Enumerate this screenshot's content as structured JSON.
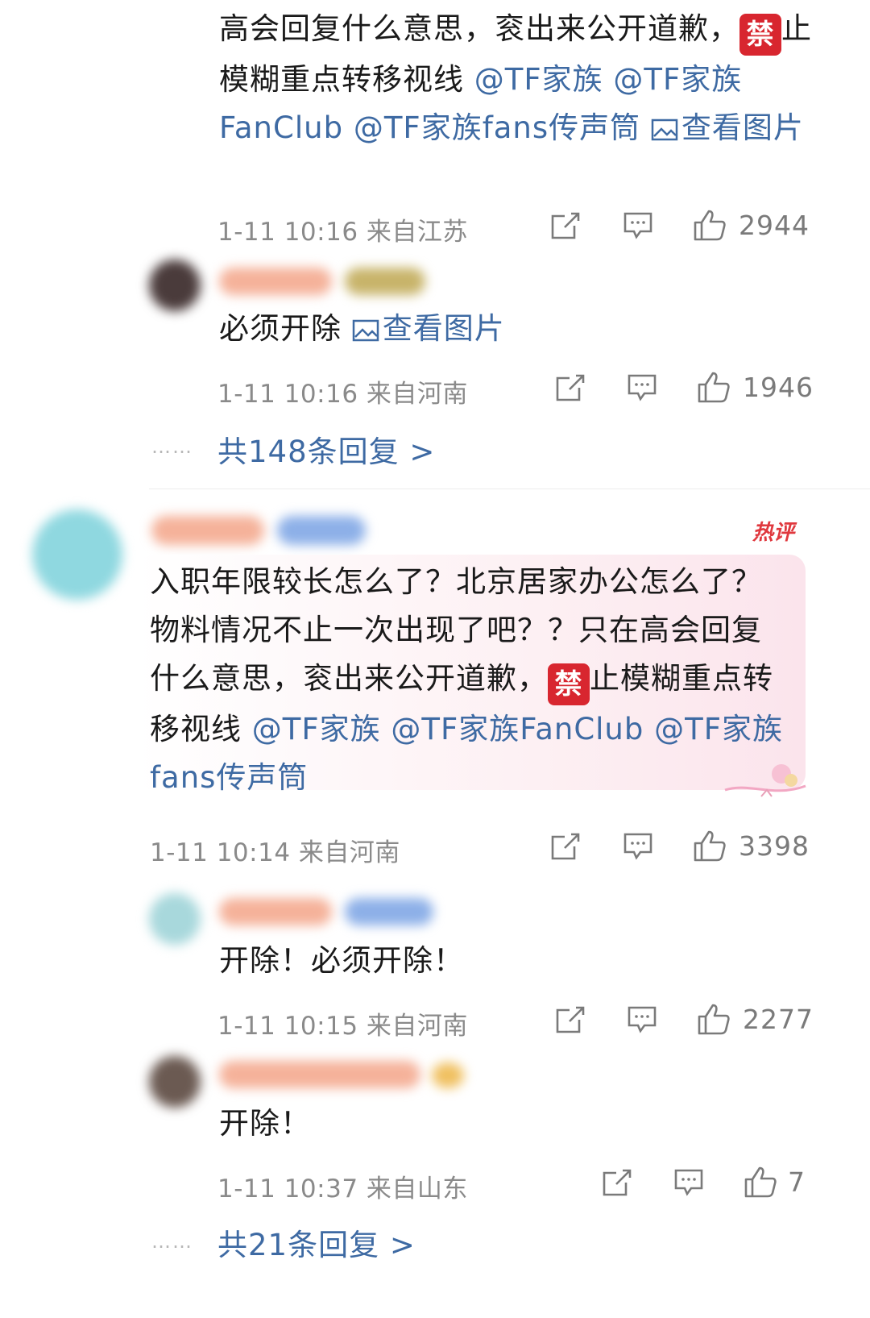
{
  "comments": [
    {
      "id": "reply-top",
      "text_plain": "高会回复什么意思，衮出来公开道歉，",
      "ban_char": "禁",
      "text_after_ban": "止模糊重点转移视线",
      "mentions": [
        "@TF家族",
        "@TF家族FanClub",
        "@TF家族fans传声筒"
      ],
      "view_image": "查看图片",
      "meta": "1-11 10:16 来自江苏",
      "likes": "2944"
    },
    {
      "id": "reply-2",
      "text": "必须开除",
      "view_image": "查看图片",
      "meta": "1-11 10:16 来自河南",
      "likes": "1946"
    },
    {
      "id": "main-comment",
      "badge": "热评",
      "text_plain": "入职年限较长怎么了？北京居家办公怎么了？物料情况不止一次出现了吧？？只在高会回复什么意思，衮出来公开道歉，",
      "ban_char": "禁",
      "text_after_ban": "止模糊重点转移视线",
      "mentions": [
        "@TF家族",
        "@TF家族FanClub",
        "@TF家族fans传声筒"
      ],
      "meta": "1-11 10:14 来自河南",
      "likes": "3398"
    },
    {
      "id": "reply-3",
      "text": "开除！必须开除！",
      "meta": "1-11 10:15 来自河南",
      "likes": "2277"
    },
    {
      "id": "reply-4",
      "text": "开除！",
      "meta": "1-11 10:37 来自山东",
      "likes": "7"
    }
  ],
  "more_replies_1": "共148条回复 >",
  "more_replies_2": "共21条回复 >",
  "dots": "……",
  "colors": {
    "link": "#3e6aa3",
    "ban": "#d8262f",
    "hot": "#e0383e"
  }
}
